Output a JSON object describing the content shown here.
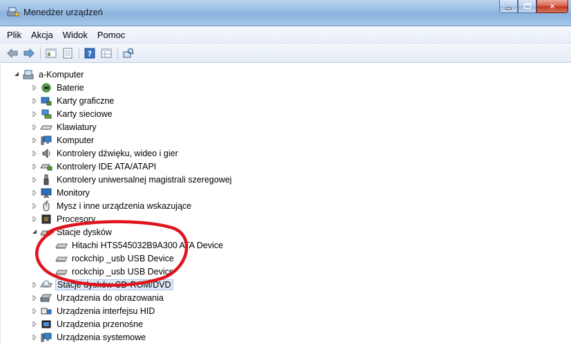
{
  "window": {
    "title": "Menedżer urządzeń",
    "icon": "device-manager-icon",
    "controls": [
      "minimize-icon",
      "maximize-icon",
      "close-icon"
    ]
  },
  "menu": {
    "items": [
      "Plik",
      "Akcja",
      "Widok",
      "Pomoc"
    ]
  },
  "toolbar": {
    "buttons": [
      "back-arrow-icon",
      "forward-arrow-icon",
      "properties-view-icon",
      "page-icon",
      "help-icon",
      "view-grid-icon",
      "scan-hardware-icon"
    ]
  },
  "tree": {
    "root": "a-Komputer",
    "categories": [
      "Baterie",
      "Karty graficzne",
      "Karty sieciowe",
      "Klawiatury",
      "Komputer",
      "Kontrolery dźwięku, wideo i gier",
      "Kontrolery IDE ATA/ATAPI",
      "Kontrolery uniwersalnej magistrali szeregowej",
      "Monitory",
      "Mysz i inne urządzenia wskazujące",
      "Procesory",
      "Stacje dysków",
      "Stacje dysków CD-ROM/DVD",
      "Urządzenia do obrazowania",
      "Urządzenia interfejsu HID",
      "Urządzenia przenośne",
      "Urządzenia systemowe"
    ],
    "disk_drives": [
      "Hitachi HTS545032B9A300 ATA Device",
      "rockchip _usb USB Device",
      "rockchip _usb USB Device"
    ]
  },
  "colors": {
    "annotation": "#e0141e",
    "selection": "#dce8f6"
  }
}
